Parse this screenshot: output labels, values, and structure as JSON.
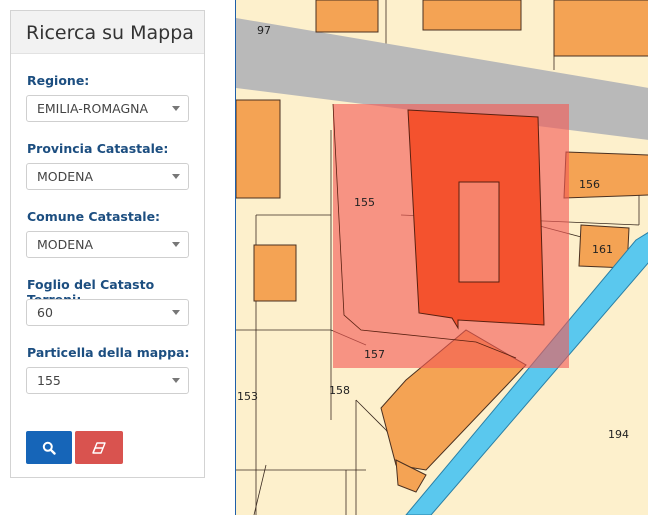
{
  "panel": {
    "title": "Ricerca su Mappa",
    "fields": [
      {
        "label": "Regione:",
        "value": "EMILIA-ROMAGNA"
      },
      {
        "label": "Provincia Catastale:",
        "value": "MODENA"
      },
      {
        "label": "Comune Catastale:",
        "value": "MODENA"
      },
      {
        "label": "Foglio del Catasto Terreni:",
        "value": "60"
      },
      {
        "label": "Particella della mappa:",
        "value": "155"
      }
    ],
    "buttons": {
      "search_icon": "search-icon",
      "clear_icon": "eraser-icon"
    }
  },
  "map": {
    "parcel_labels": [
      "97",
      "155",
      "156",
      "161",
      "157",
      "158",
      "153",
      "194"
    ],
    "colors": {
      "ground": "#fdf0cc",
      "building": "#f4a354",
      "road": "#b9b9b9",
      "canal": "#5ac8ee",
      "highlight": "#f45a55",
      "highlight_building": "#f4522e"
    }
  }
}
